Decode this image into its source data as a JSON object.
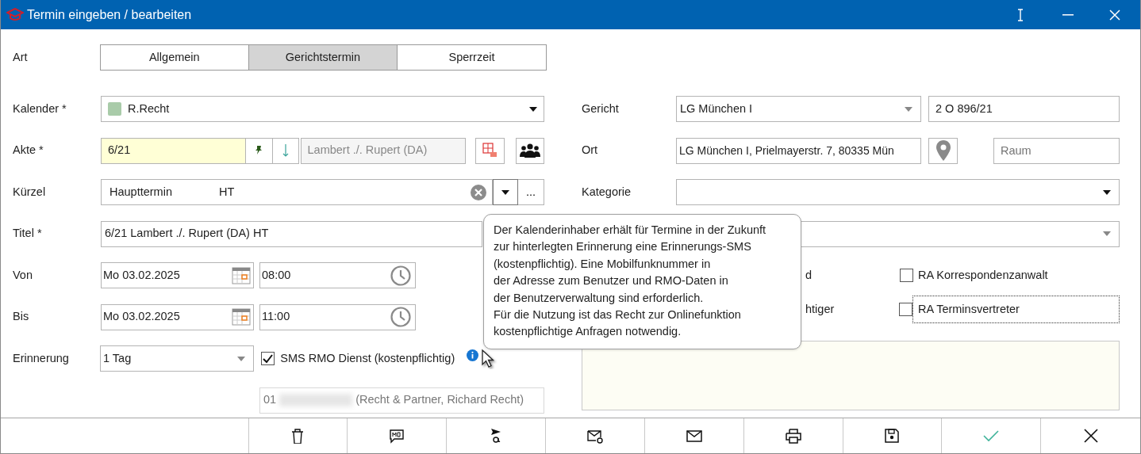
{
  "window": {
    "title": "Termin eingeben / bearbeiten"
  },
  "art": {
    "label": "Art",
    "options": [
      {
        "label": "Allgemein",
        "selected": false
      },
      {
        "label": "Gerichtstermin",
        "selected": true
      },
      {
        "label": "Sperrzeit",
        "selected": false
      }
    ]
  },
  "kalender": {
    "label": "Kalender *",
    "value": "R.Recht",
    "color": "#a9cba9"
  },
  "akte": {
    "label": "Akte *",
    "value": "6/21",
    "party": "Lambert ./. Rupert (DA)"
  },
  "kuerzel": {
    "label": "Kürzel",
    "value": "Haupttermin",
    "code": "HT",
    "more": "..."
  },
  "titel": {
    "label": "Titel *",
    "value": "6/21 Lambert ./. Rupert (DA) HT"
  },
  "von": {
    "label": "Von",
    "date": "Mo 03.02.2025",
    "time": "08:00"
  },
  "bis": {
    "label": "Bis",
    "date": "Mo 03.02.2025",
    "time": "11:00"
  },
  "erinnerung": {
    "label": "Erinnerung",
    "value": "1 Tag",
    "sms": {
      "label": "SMS RMO Dienst (kostenpflichtig)",
      "checked": true
    },
    "phone_prefix": "01",
    "phone_owner": "(Recht & Partner, Richard Recht)"
  },
  "gericht": {
    "label": "Gericht",
    "value": "LG München I",
    "aktenzeichen": "2 O 896/21"
  },
  "ort": {
    "label": "Ort",
    "value": "LG München I, Prielmayerstr. 7, 80335 Mün",
    "raum_placeholder": "Raum"
  },
  "kategorie": {
    "label": "Kategorie"
  },
  "options": [
    {
      "kind": "fragment",
      "label": "d"
    },
    {
      "kind": "checkbox",
      "label": "RA Korrespondenzanwalt",
      "checked": false
    },
    {
      "kind": "fragment",
      "label": "htiger"
    },
    {
      "kind": "checkbox",
      "label": "RA Terminsvertreter",
      "checked": false
    }
  ],
  "tooltip": {
    "lines": [
      "Der Kalenderinhaber erhält für Termine in der Zukunft",
      "zur hinterlegten Erinnerung eine Erinnerungs-SMS",
      "(kostenpflichtig). Eine Mobilfunknummer in",
      "der Adresse zum Benutzer und RMO-Daten in",
      "der Benutzerverwaltung sind erforderlich.",
      "Für die Nutzung ist das Recht zur Onlinefunktion",
      "kostenpflichtige Anfragen notwendig."
    ]
  }
}
